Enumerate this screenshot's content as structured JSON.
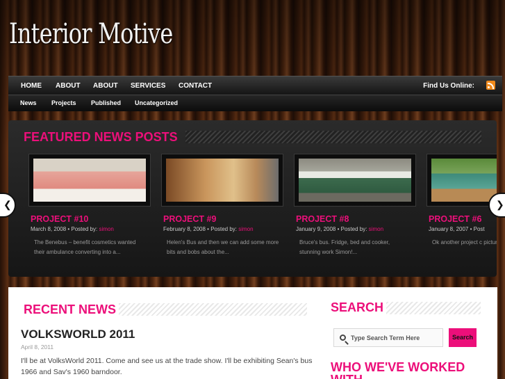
{
  "site": {
    "logo": "Interior Motive"
  },
  "nav": {
    "primary": [
      "HOME",
      "ABOUT",
      "ABOUT",
      "SERVICES",
      "CONTACT"
    ],
    "find_us": "Find Us Online:",
    "rss_icon": "rss-icon",
    "secondary": [
      "News",
      "Projects",
      "Published",
      "Uncategorized"
    ]
  },
  "featured": {
    "title": "FEATURED NEWS POSTS",
    "posts": [
      {
        "title": "PROJECT #10",
        "date": "March 8, 2008",
        "posted_by": "Posted by:",
        "author": "simon",
        "excerpt": "The Benebus – benefit cosmetics wanted their ambulance converting into a..."
      },
      {
        "title": "PROJECT #9",
        "date": "February 8, 2008",
        "posted_by": "Posted by:",
        "author": "simon",
        "excerpt": "Helen's Bus and then we can add some more bits and bobs about the..."
      },
      {
        "title": "PROJECT #8",
        "date": "January 9, 2008",
        "posted_by": "Posted by:",
        "author": "simon",
        "excerpt": "Bruce's bus. Fridge, bed and cooker, stunning work Simon!..."
      },
      {
        "title": "PROJECT #6",
        "date": "January 8, 2007",
        "posted_by": "Post",
        "author": "",
        "excerpt": "Ok another project c pictures...."
      }
    ],
    "arrow_left": "❮",
    "arrow_right": "❯"
  },
  "recent": {
    "title": "RECENT NEWS",
    "post_title": "VOLKSWORLD 2011",
    "post_date": "April 8, 2011",
    "post_text": "I'll be at VolksWorld 2011. Come and see us at the trade show. I'll be exhibiting Sean's bus 1966 and Sav's 1960 barndoor."
  },
  "sidebar": {
    "search_title": "SEARCH",
    "search_placeholder": "Type Search Term Here",
    "search_button": "Search",
    "who_title": "WHO WE'VE WORKED WITH"
  },
  "colors": {
    "accent": "#ec0f7a",
    "nav_bg": "#1c1c1c"
  }
}
